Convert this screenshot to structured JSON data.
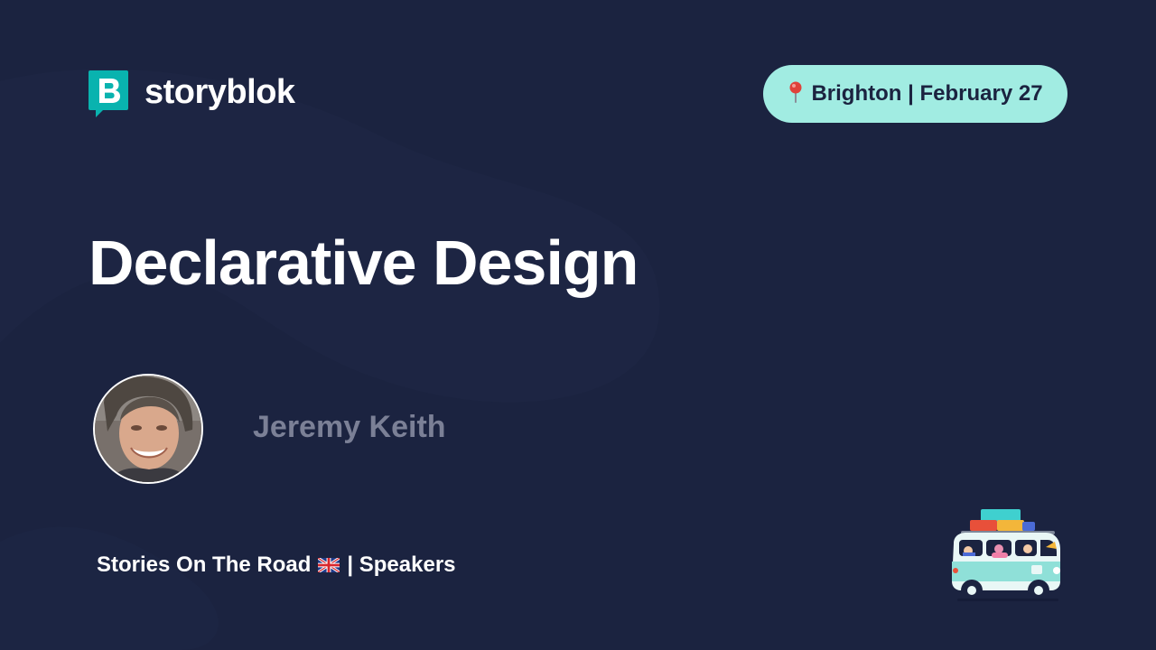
{
  "brand": {
    "name": "storyblok",
    "logo_letter": "B",
    "accent_color": "#09b3af"
  },
  "location": {
    "icon": "map-pin-icon",
    "text": "Brighton | February 27",
    "pill_color": "#a1ece2"
  },
  "talk": {
    "title": "Declarative Design"
  },
  "speaker": {
    "name": "Jeremy Keith",
    "avatar": "speaker-avatar-photo"
  },
  "footer": {
    "series": "Stories On The Road",
    "flag": "uk-flag-icon",
    "suffix": "| Speakers"
  },
  "illustration": {
    "icon": "camper-van-illustration"
  },
  "colors": {
    "background": "#1b2340",
    "title": "#ffffff",
    "speaker_name": "#7b8096"
  }
}
